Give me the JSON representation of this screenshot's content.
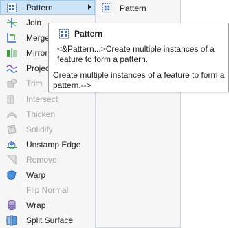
{
  "menu": {
    "items": [
      {
        "label": "Pattern",
        "icon": "pattern-icon",
        "state": "active",
        "submenu": true
      },
      {
        "label": "Join",
        "icon": "join-icon",
        "state": "enabled"
      },
      {
        "label": "Merge",
        "icon": "merge-icon",
        "state": "enabled"
      },
      {
        "label": "Mirror",
        "icon": "mirror-icon",
        "state": "enabled"
      },
      {
        "label": "Project",
        "icon": "project-icon",
        "state": "enabled"
      },
      {
        "label": "Trim",
        "icon": "trim-icon",
        "state": "disabled"
      },
      {
        "label": "Intersect",
        "icon": "intersect-icon",
        "state": "disabled"
      },
      {
        "label": "Thicken",
        "icon": "thicken-icon",
        "state": "disabled"
      },
      {
        "label": "Solidify",
        "icon": "solidify-icon",
        "state": "disabled"
      },
      {
        "label": "Unstamp Edge",
        "icon": "unstamp-edge-icon",
        "state": "enabled"
      },
      {
        "label": "Remove",
        "icon": "remove-icon",
        "state": "disabled"
      },
      {
        "label": "Warp",
        "icon": "warp-icon",
        "state": "enabled"
      },
      {
        "label": "Flip Normal",
        "icon": "",
        "state": "disabled"
      },
      {
        "label": "Wrap",
        "icon": "wrap-icon",
        "state": "enabled"
      },
      {
        "label": "Split Surface",
        "icon": "split-surface-icon",
        "state": "enabled"
      }
    ]
  },
  "submenu": {
    "items": [
      {
        "label": "Pattern",
        "icon": "pattern-icon"
      }
    ]
  },
  "tooltip": {
    "title": "Pattern",
    "icon": "pattern-icon",
    "body": "<&Pattern...>Create multiple instances of a feature to form a pattern.",
    "description": "Create multiple instances of a feature to form a pattern.-->"
  },
  "colors": {
    "menu_bg": "#f6f6f6",
    "active_bg": "#cce4f7",
    "disabled_text": "#a3a3a3",
    "icon_blue": "#3b6bbd",
    "icon_green": "#3c9a3c"
  }
}
